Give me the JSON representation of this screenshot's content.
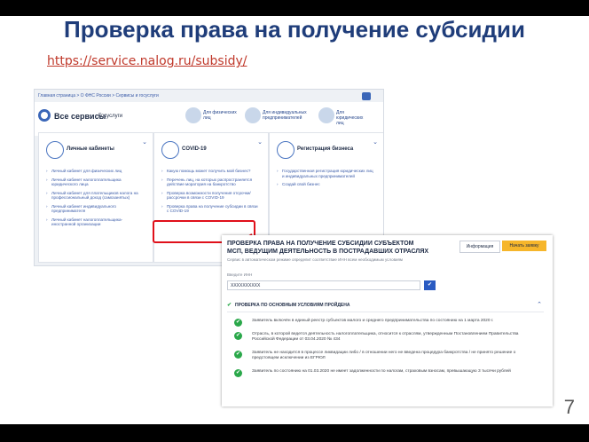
{
  "slide": {
    "title": "Проверка права на получение субсидии",
    "url": "https://service.nalog.ru/subsidy/",
    "page_number": "7"
  },
  "portal": {
    "breadcrumbs": "Главная страница  >  О ФНС России  >  Сервисы и госуслуги",
    "heading": "Все сервисы",
    "tab": "Госуслуги",
    "audiences": [
      "Для физических лиц",
      "Для индивидуальных предпринимателей",
      "Для юридических лиц"
    ],
    "cards": [
      {
        "title": "Личные кабинеты",
        "icon": "people-icon",
        "items": [
          "Личный кабинет для физических лиц",
          "Личный кабинет налогоплательщика юридического лица",
          "Личный кабинет для плательщиков налога на профессиональный доход (самозанятых)",
          "Личный кабинет индивидуального предпринимателя",
          "Личный кабинет налогоплательщика-иностранной организации"
        ]
      },
      {
        "title": "COVID-19",
        "icon": "chart-icon",
        "items": [
          "Какую помощь может получить мой бизнес?",
          "Перечень лиц, на которых распространяется действие моратория на банкротство",
          "Проверка возможности получения отсрочки/рассрочки в связи с COVID-19",
          "Проверка права на получение субсидии в связи с COVID-19"
        ]
      },
      {
        "title": "Регистрация бизнеса",
        "icon": "briefcase-icon",
        "items": [
          "Государственная регистрация юридических лиц и индивидуальных предпринимателей",
          "Создай свой бизнес"
        ]
      }
    ]
  },
  "subsidy": {
    "title": "ПРОВЕРКА ПРАВА НА ПОЛУЧЕНИЕ СУБСИДИИ СУБЪЕКТОМ МСП, ВЕДУЩИМ ДЕЯТЕЛЬНОСТЬ В ПОСТРАДАВШИХ ОТРАСЛЯХ",
    "subtitle": "Сервис в автоматическом режиме определит соответствие ИНН всем необходимым условиям",
    "info_button": "Информация",
    "apply_button": "Начать заявку",
    "inn_label": "Введите ИНН",
    "inn_value": "XXXXXXXXXX",
    "check_header": "ПРОВЕРКА ПО ОСНОВНЫМ УСЛОВИЯМ ПРОЙДЕНА",
    "conditions": [
      "Заявитель включён в единый реестр субъектов малого и среднего предпринимательства по состоянию на 1 марта 2020 г.",
      "Отрасль, в которой ведется деятельность налогоплательщика, относится к отраслям, утвержденным Постановлением Правительства Российской Федерации от 03.04.2020 № 434",
      "Заявитель не находится в процессе ликвидации либо / в отношении него не введена процедура банкротства / не принято решение о предстоящем исключении из ЕГРЮЛ",
      "Заявитель по состоянию на 01.03.2020 не имеет задолженности по налогам, страховым взносам, превышающую 3 тысячи рублей"
    ]
  },
  "colors": {
    "title": "#1f3d7a",
    "url": "#c0392b",
    "highlight": "#e0101a",
    "check": "#2aa84a",
    "accent": "#f6b62b"
  }
}
